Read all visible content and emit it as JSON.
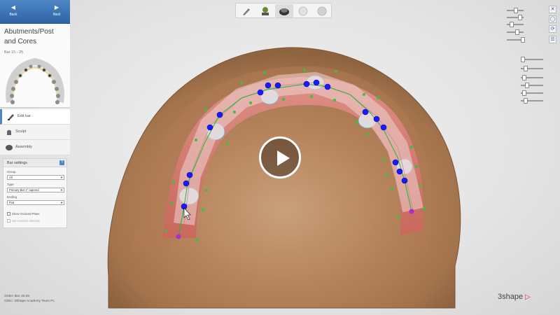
{
  "nav": {
    "back_label": "Back",
    "next_label": "Next"
  },
  "panel": {
    "title": "Abutments/Post and Cores",
    "bar_range": "Bar 15 - 25"
  },
  "steps": [
    {
      "label": "Edit bar",
      "icon": "edit-bar-icon",
      "active": true
    },
    {
      "label": "Sculpt",
      "icon": "sculpt-icon",
      "active": false
    },
    {
      "label": "Assembly",
      "icon": "assembly-icon",
      "active": false
    }
  ],
  "bar_settings": {
    "title": "Bar settings",
    "help": "?",
    "group_label": "Group",
    "group_value": "All",
    "type_label": "Type",
    "type_value": "Primary Bar 2° tapered",
    "ending_label": "Ending",
    "ending_value": "Flat",
    "show_occlusal_plane": "Show Occlusal Plane",
    "set_insertion_direction": "Set insertion direction"
  },
  "order_info": {
    "order_line": "Order:   Bar 15-25",
    "clinic_line": "Clinic:   3Shape Academy Team PL"
  },
  "logo": {
    "text": "3shape",
    "mark": "▷"
  },
  "colors": {
    "accent": "#2f65a6",
    "bar_node": "#1a1aff",
    "handle": "#39c23a",
    "bar_end": "#b02ad0",
    "gum": "#d97a6c"
  }
}
